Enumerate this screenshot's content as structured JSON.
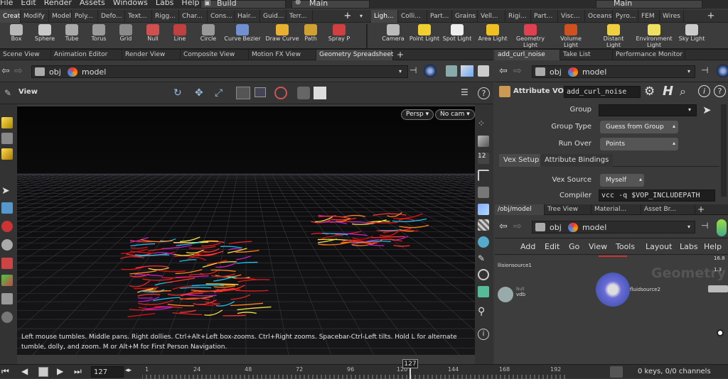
{
  "menu": [
    "File",
    "Edit",
    "Render",
    "Assets",
    "Windows",
    "Labs",
    "Help"
  ],
  "desktop": {
    "build": "Build",
    "main": "Main",
    "main2": "Main"
  },
  "shelf_tabs_left": [
    "Create",
    "Modify",
    "Model",
    "Poly...",
    "Defo...",
    "Text...",
    "Rigg...",
    "Char...",
    "Cons...",
    "Hair...",
    "Guid...",
    "Terr..."
  ],
  "shelf_tabs_right": [
    "Ligh...",
    "Colli...",
    "Part...",
    "Grains",
    "Vell...",
    "Rigi...",
    "Part...",
    "Visc...",
    "Oceans",
    "Pyro...",
    "FEM",
    "Wires"
  ],
  "tools_left": [
    {
      "label": "Box",
      "icon": "box-icon",
      "color": "#b8b8b8"
    },
    {
      "label": "Sphere",
      "icon": "sphere-icon",
      "color": "#c9c9c9"
    },
    {
      "label": "Tube",
      "icon": "tube-icon",
      "color": "#aaaaaa"
    },
    {
      "label": "Torus",
      "icon": "torus-icon",
      "color": "#9a9a9a"
    },
    {
      "label": "Grid",
      "icon": "grid-icon",
      "color": "#8a8a8a"
    },
    {
      "label": "Null",
      "icon": "null-icon",
      "color": "#d05050"
    },
    {
      "label": "Line",
      "icon": "line-icon",
      "color": "#c04040"
    },
    {
      "label": "Circle",
      "icon": "circle-icon",
      "color": "#999999"
    },
    {
      "label": "Curve Bezier",
      "icon": "curve-bezier-icon",
      "color": "#7090d0"
    },
    {
      "label": "Draw Curve",
      "icon": "draw-curve-icon",
      "color": "#e8b030"
    },
    {
      "label": "Path",
      "icon": "path-icon",
      "color": "#d0a030"
    },
    {
      "label": "Spray P",
      "icon": "spray-paint-icon",
      "color": "#d04040"
    }
  ],
  "tools_right": [
    {
      "label": "Camera",
      "icon": "camera-icon",
      "color": "#bbbbbb"
    },
    {
      "label": "Point Light",
      "icon": "point-light-icon",
      "color": "#f0d030"
    },
    {
      "label": "Spot Light",
      "icon": "spot-light-icon",
      "color": "#eeeeee"
    },
    {
      "label": "Area Light",
      "icon": "area-light-icon",
      "color": "#f0c020"
    },
    {
      "label": "Geometry Light",
      "icon": "geometry-light-icon",
      "color": "#e04050"
    },
    {
      "label": "Volume Light",
      "icon": "volume-light-icon",
      "color": "#d05020"
    },
    {
      "label": "Distant Light",
      "icon": "distant-light-icon",
      "color": "#f0d040"
    },
    {
      "label": "Environment Light",
      "icon": "environment-light-icon",
      "color": "#f0e060"
    },
    {
      "label": "Sky Light",
      "icon": "sky-light-icon",
      "color": "#cccccc"
    }
  ],
  "left_pane": {
    "tabs": [
      "Scene View",
      "Animation Editor",
      "Render View",
      "Composite View",
      "Motion FX View",
      "Geometry Spreadsheet"
    ],
    "path": [
      "obj",
      "model"
    ],
    "view_label": "View",
    "persp": "Persp",
    "nocam": "No cam",
    "status_line1": "Left mouse tumbles. Middle pans. Right dollies. Ctrl+Alt+Left box-zooms. Ctrl+Right zooms. Spacebar-Ctrl-Left tilts. Hold L for alternate",
    "status_line2": "tumble, dolly, and zoom.     M or Alt+M for First Person Navigation."
  },
  "param_pane": {
    "tabs": [
      "add_curl_noise",
      "Take List",
      "Performance Monitor"
    ],
    "path": [
      "obj",
      "model"
    ],
    "node_type": "Attribute VOP",
    "node_name": "add_curl_noise",
    "group_label": "Group",
    "group_value": "",
    "group_type_label": "Group Type",
    "group_type_value": "Guess from Group",
    "run_over_label": "Run Over",
    "run_over_value": "Points",
    "subtabs": [
      "Vex Setup",
      "Attribute Bindings"
    ],
    "vex_source_label": "Vex Source",
    "vex_source_value": "Myself",
    "compiler_label": "Compiler",
    "compiler_value": "vcc -q $VOP_INCLUDEPATH"
  },
  "network_pane": {
    "tabs": [
      "/obj/model",
      "Tree View",
      "Material...",
      "Asset Br..."
    ],
    "path": [
      "obj",
      "model"
    ],
    "menu": [
      "Add",
      "Edit",
      "Go",
      "View",
      "Tools",
      "Layout",
      "Labs",
      "Help"
    ],
    "watermark": "Geometry",
    "nodes": [
      {
        "name": "llisionsource1"
      },
      {
        "name": "vdb",
        "sub": "Null"
      },
      {
        "name": "fluidsource2"
      }
    ],
    "side_values": [
      "16.8",
      "1.3"
    ]
  },
  "timeline": {
    "frame": "127",
    "ticks": [
      "1",
      "24",
      "48",
      "72",
      "96",
      "120",
      "144",
      "168",
      "192"
    ],
    "keys": "0 keys, 0/0 channels"
  }
}
